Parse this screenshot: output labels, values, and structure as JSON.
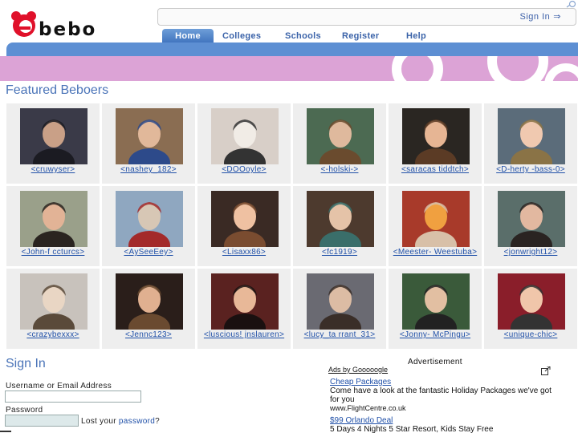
{
  "header": {
    "logo_text": "bebo",
    "signin_label": "Sign In",
    "signin_arrow": "⇒"
  },
  "nav": {
    "tabs": [
      {
        "label": "Home",
        "active": true
      },
      {
        "label": "Colleges",
        "active": false
      },
      {
        "label": "Schools",
        "active": false
      },
      {
        "label": "Register",
        "active": false
      },
      {
        "label": "Help",
        "active": false
      }
    ]
  },
  "colors": {
    "accent_blue": "#5d8fd3",
    "banner_pink": "#dca3d6",
    "logo_red": "#e0102a",
    "link": "#2050a8"
  },
  "featured": {
    "title": "Featured Beboers",
    "users": [
      {
        "name": "<cruwyser>"
      },
      {
        "name": "<nashey_182>"
      },
      {
        "name": "<DOOoyle>"
      },
      {
        "name": "<-holski->"
      },
      {
        "name": "<saracas tiddtch>"
      },
      {
        "name": "<D-herty -bass-0>"
      },
      {
        "name": "<John-f ccturcs>"
      },
      {
        "name": "<AySeeEey>"
      },
      {
        "name": "<Lisaxx86>"
      },
      {
        "name": "<fc1919>"
      },
      {
        "name": "<Meester- Weestuba>"
      },
      {
        "name": "<jonwright12>"
      },
      {
        "name": "<crazybexxx>"
      },
      {
        "name": "<Jennc123>"
      },
      {
        "name": "<luscious! jnslauren>"
      },
      {
        "name": "<lucy_ta rrant_31>"
      },
      {
        "name": "<Jonny- McPingu>"
      },
      {
        "name": "<unique-chic>"
      }
    ]
  },
  "signin": {
    "title": "Sign In",
    "username_label": "Username or Email Address",
    "username_value": "",
    "password_label": "Password",
    "password_value": "",
    "lost_prefix": "Lost your ",
    "lost_link": "password",
    "lost_suffix": "?"
  },
  "advert": {
    "heading": "Advertisement",
    "ads_by": "Ads by Gooooogle",
    "items": [
      {
        "title": "Cheap Packages",
        "text": "Come have a look at the fantastic Holiday Packages we've got for you",
        "url": "www.FlightCentre.co.uk"
      },
      {
        "title": "$99 Orlando Deal",
        "text": "5 Days 4 Nights 5 Star Resort, Kids Stay Free",
        "url": ""
      }
    ]
  }
}
